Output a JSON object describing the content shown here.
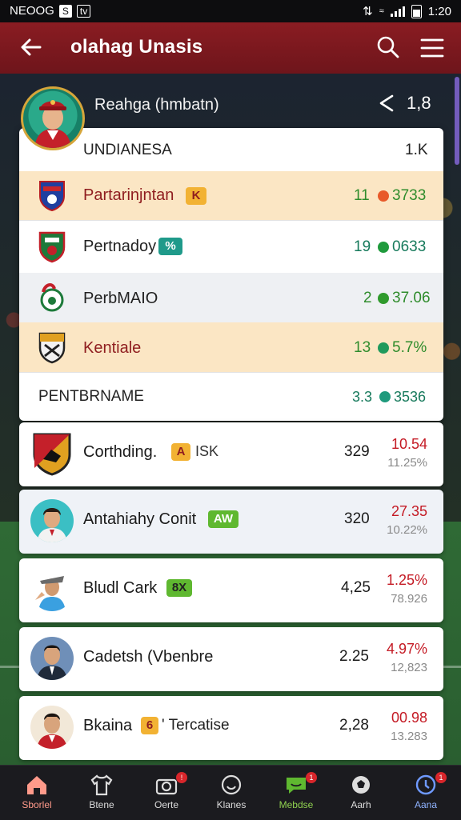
{
  "status_bar": {
    "carrier": "NEOOG",
    "time": "1:20"
  },
  "app_bar": {
    "title": "olahag Unasis"
  },
  "profile": {
    "name": "Reahga (hmbatn)",
    "count": "1,8"
  },
  "card": {
    "header": {
      "label": "UNDIANESA",
      "value": "1.K"
    },
    "rows": [
      {
        "label": "Partarinjntan",
        "badge": "K",
        "num": "11",
        "value": "3733",
        "dot": "#e85a2a"
      },
      {
        "label": "Pertnadoy",
        "badge": "%",
        "num": "19",
        "value": "0633",
        "dot": "#1f9a3c"
      },
      {
        "label": "PerbMAIO",
        "num": "2",
        "value": "37.06",
        "dot": "#2f9a2c"
      },
      {
        "label": "Kentiale",
        "num": "13",
        "value": "5.7%",
        "dot": "#1f9a5c"
      }
    ],
    "section": {
      "label": "PENTBRNAME",
      "num": "3.3",
      "value": "3536",
      "dot": "#1f9a7c"
    }
  },
  "players": [
    {
      "name": "Corthding.",
      "badge": "A",
      "extra": "ISK",
      "value": "329",
      "change": "10.54",
      "sub": "11.25%"
    },
    {
      "name": "Antahiahy Conit",
      "badge": "AW",
      "value": "320",
      "change": "27.35",
      "sub": "10.22%"
    },
    {
      "name": "Bludl Cark",
      "badge": "8X",
      "value": "4,25",
      "change": "1.25%",
      "sub": "78.926"
    },
    {
      "name": "Cadetsh (Vbenbre",
      "value": "2.25",
      "change": "4.97%",
      "sub": "12,823"
    },
    {
      "name": "Bkaina",
      "badge": "6",
      "extra": "' Tercatise",
      "value": "2,28",
      "change": "00.98",
      "sub": "13.283"
    }
  ],
  "bottom_nav": [
    {
      "label": "Sborlel",
      "icon": "home-icon",
      "active": true
    },
    {
      "label": "Btene",
      "icon": "jersey-icon"
    },
    {
      "label": "Oerte",
      "icon": "camera-icon",
      "badge": "!"
    },
    {
      "label": "Klanes",
      "icon": "smile-icon"
    },
    {
      "label": "Mebdse",
      "icon": "chat-icon",
      "badge": "1"
    },
    {
      "label": "Aarh",
      "icon": "soccer-ball-icon"
    },
    {
      "label": "Aana",
      "icon": "info-icon",
      "badge": "1"
    }
  ]
}
